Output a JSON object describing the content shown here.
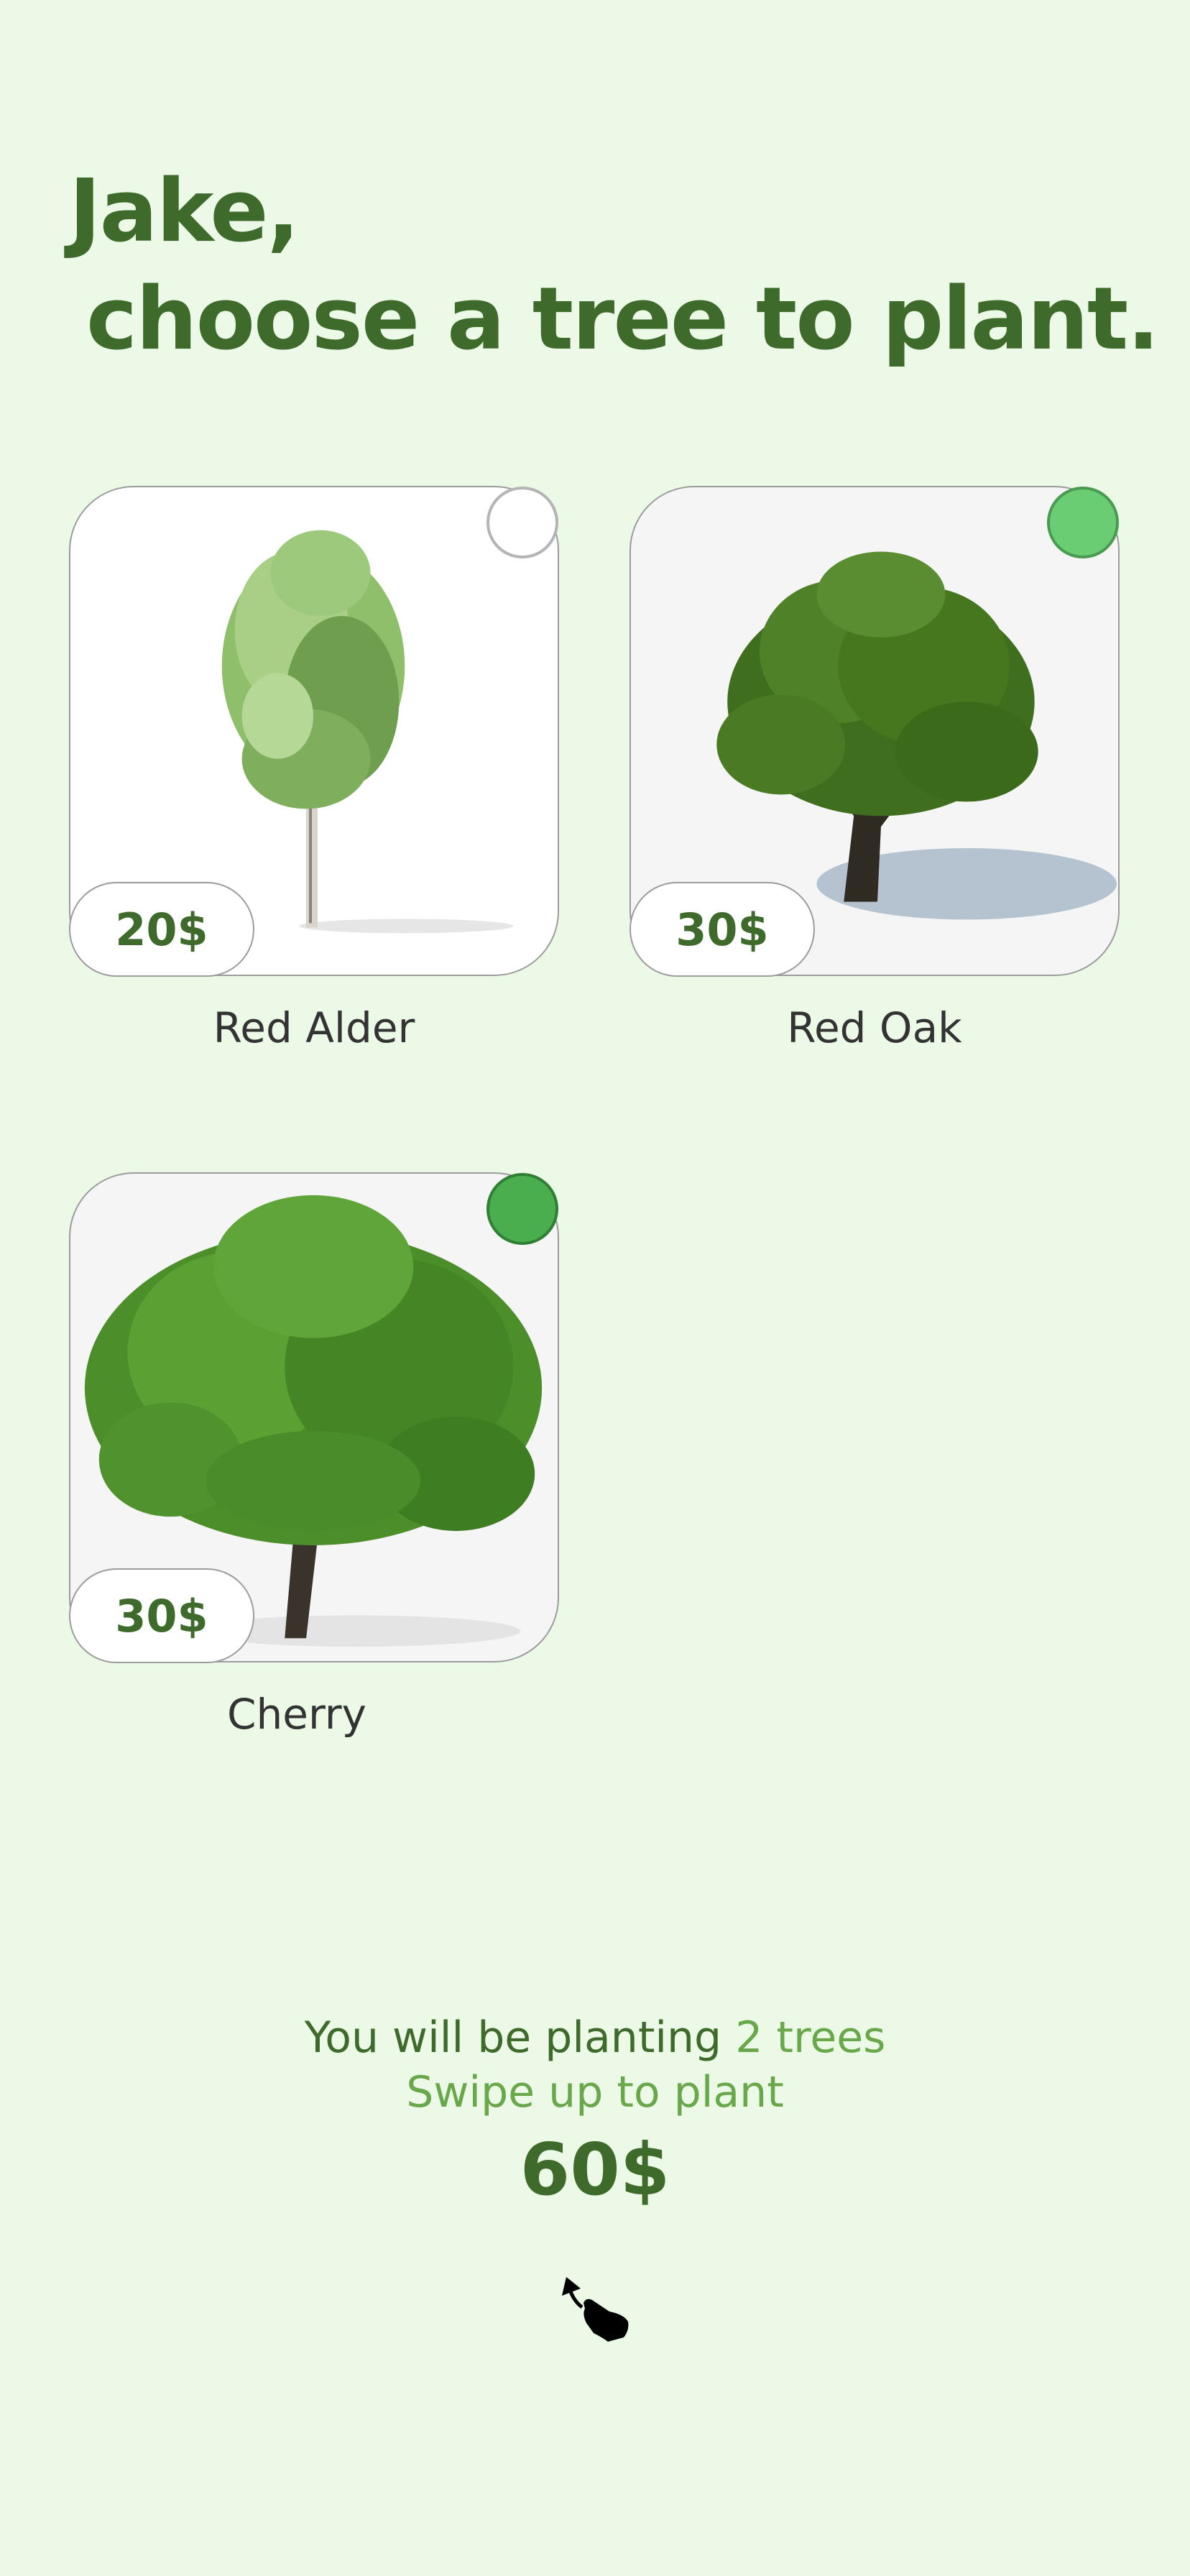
{
  "header": {
    "name_line": "Jake,",
    "prompt_line": "choose a tree to plant."
  },
  "trees": [
    {
      "name": "Red Alder",
      "price": "20$",
      "selected": false
    },
    {
      "name": "Red Oak",
      "price": "30$",
      "selected": true
    },
    {
      "name": "Cherry",
      "price": "30$",
      "selected": true
    }
  ],
  "summary": {
    "prefix": "You will be planting ",
    "count": "2 trees",
    "swipe_hint": "Swipe up to plant",
    "total": "60$"
  },
  "icons": {
    "swipe": "swipe-up-hand-icon",
    "check_off": "circle-unchecked-icon",
    "check_on": "circle-checked-icon"
  },
  "colors": {
    "background": "#ebf9e6",
    "title": "#3e6b2c",
    "accent": "#68a84a",
    "selected_dot_1": "#6acd74",
    "selected_dot_2": "#4aae4e"
  }
}
